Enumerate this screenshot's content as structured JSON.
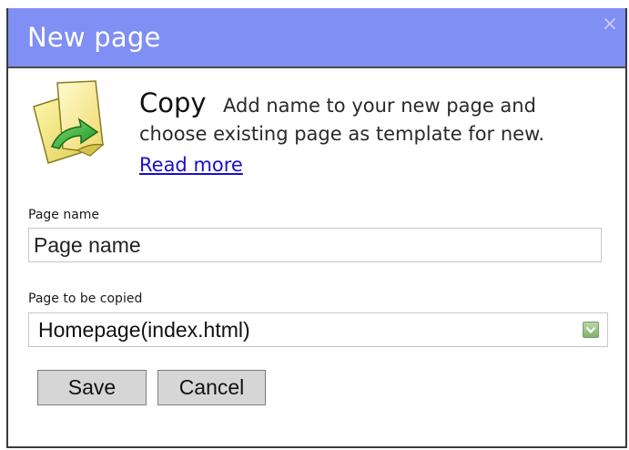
{
  "dialog": {
    "title": "New page",
    "close_glyph": "×"
  },
  "intro": {
    "icon": "copy-page-icon",
    "heading": "Copy",
    "description_line1": "Add name to your new page and",
    "description_line2": "choose existing page as template for new.",
    "read_more": "Read more"
  },
  "form": {
    "page_name": {
      "label": "Page name",
      "value": "Page name"
    },
    "page_to_copy": {
      "label": "Page to be copied",
      "selected": "Homepage(index.html)"
    }
  },
  "buttons": {
    "save": "Save",
    "cancel": "Cancel"
  },
  "colors": {
    "titlebar": "#7f8ff3",
    "link": "#1a0dcc",
    "select_arrow": "#7fb26a"
  }
}
